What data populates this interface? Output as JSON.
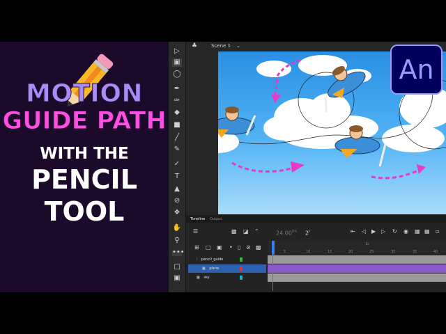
{
  "title": {
    "line1": "MOTION",
    "line2": "GUIDE PATH",
    "line3": "WITH THE",
    "line4": "PENCIL",
    "line5": "TOOL"
  },
  "scene": {
    "label": "Scene 1"
  },
  "badge": {
    "text": "An"
  },
  "timeline": {
    "tabs": [
      "Timeline",
      "Output"
    ],
    "fps": "24.00",
    "fps_unit": "FPS",
    "current_frame": "2",
    "current_frame_unit": "F",
    "ruler_ticks": [
      "5",
      "10",
      "15",
      "20",
      "25",
      "30",
      "35",
      "40"
    ],
    "ruler_top_label": "1s",
    "layers": [
      {
        "name": "pencil_guide",
        "color": "#2bbf3a",
        "selected": false
      },
      {
        "name": "plane",
        "color": "#e0303a",
        "selected": true
      },
      {
        "name": "sky",
        "color": "#1ab0c8",
        "selected": false
      }
    ]
  },
  "colors": {
    "title_purple": "#a98cf5",
    "title_pink": "#ff4fe0",
    "accent_blue": "#2f7ff5",
    "arrow_magenta": "#e83ac8"
  },
  "icons": [
    "pencil-icon",
    "selection-tool-icon",
    "free-transform-icon",
    "lasso-icon",
    "pen-icon",
    "brush-icon",
    "eraser-icon",
    "rectangle-icon",
    "line-icon",
    "pencil-tool-icon",
    "text-icon",
    "paint-bucket-icon",
    "eyedropper-icon",
    "bone-icon",
    "hand-icon",
    "zoom-icon",
    "more-icon",
    "stroke-color-icon",
    "swap-colors-icon"
  ]
}
